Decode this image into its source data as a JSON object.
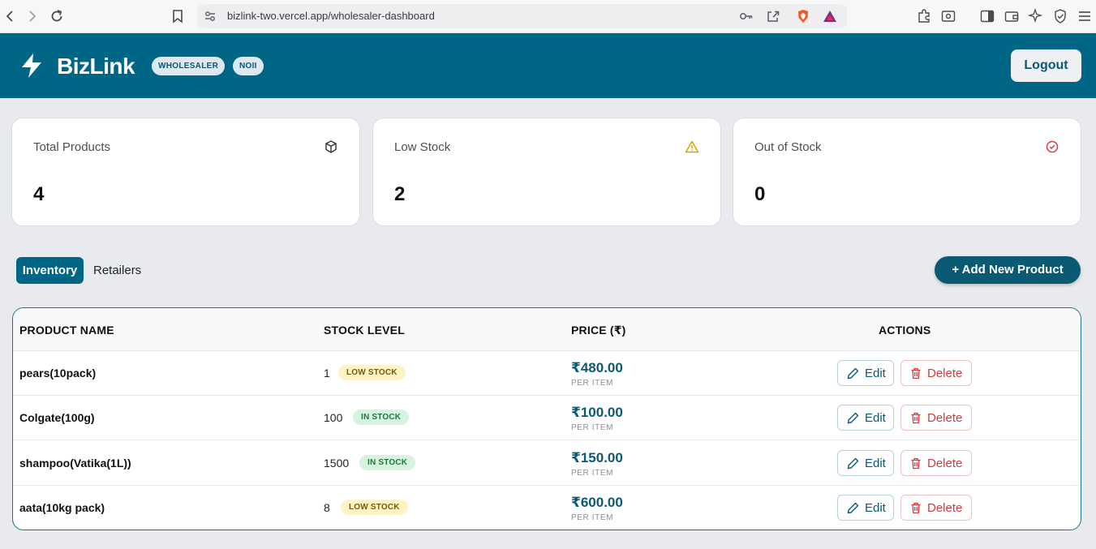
{
  "browser": {
    "url": "bizlink-two.vercel.app/wholesaler-dashboard"
  },
  "header": {
    "brand": "BizLink",
    "role_chip": "WHOLESALER",
    "user_chip": "NOII",
    "logout_label": "Logout",
    "color": "#006686"
  },
  "stats": [
    {
      "label": "Total Products",
      "value": "4",
      "icon": "box-icon"
    },
    {
      "label": "Low Stock",
      "value": "2",
      "icon": "warning-icon"
    },
    {
      "label": "Out of Stock",
      "value": "0",
      "icon": "x-circle-icon"
    }
  ],
  "tabs": [
    {
      "label": "Inventory",
      "active": true
    },
    {
      "label": "Retailers",
      "active": false
    }
  ],
  "add_button_label": "+ Add New Product",
  "table": {
    "columns": [
      "PRODUCT NAME",
      "STOCK LEVEL",
      "PRICE (₹)",
      "ACTIONS"
    ],
    "rows": [
      {
        "name": "pears(10pack)",
        "stock": "1",
        "status": "LOW STOCK",
        "price": "₹480.00",
        "per": "PER ITEM"
      },
      {
        "name": "Colgate(100g)",
        "stock": "100",
        "status": "IN STOCK",
        "price": "₹100.00",
        "per": "PER ITEM"
      },
      {
        "name": "shampoo(Vatika(1L))",
        "stock": "1500",
        "status": "IN STOCK",
        "price": "₹150.00",
        "per": "PER ITEM"
      },
      {
        "name": "aata(10kg pack)",
        "stock": "8",
        "status": "LOW STOCK",
        "price": "₹600.00",
        "per": "PER ITEM"
      }
    ],
    "edit_label": "Edit",
    "delete_label": "Delete"
  }
}
